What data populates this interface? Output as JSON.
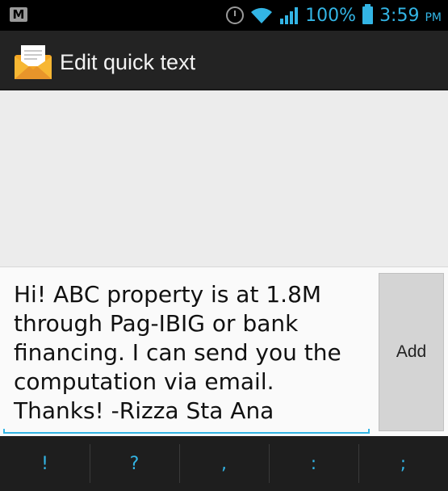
{
  "status_bar": {
    "battery_percent": "100%",
    "time": "3:59",
    "time_suffix": "PM",
    "icons": [
      "gmail-icon",
      "alarm-icon",
      "wifi-icon",
      "signal-icon",
      "battery-icon"
    ]
  },
  "action_bar": {
    "title": "Edit quick text",
    "icon": "envelope-icon"
  },
  "compose": {
    "text_value": "Hi! ABC property is at 1.8M through Pag-IBIG or bank financing. I can send you the computation via email. Thanks! -Rizza Sta Ana",
    "add_label": "Add"
  },
  "symbols": [
    "!",
    "?",
    ",",
    ":",
    ";"
  ],
  "colors": {
    "accent": "#33b5e5",
    "action_bar": "#232323",
    "status_bar": "#000000"
  }
}
